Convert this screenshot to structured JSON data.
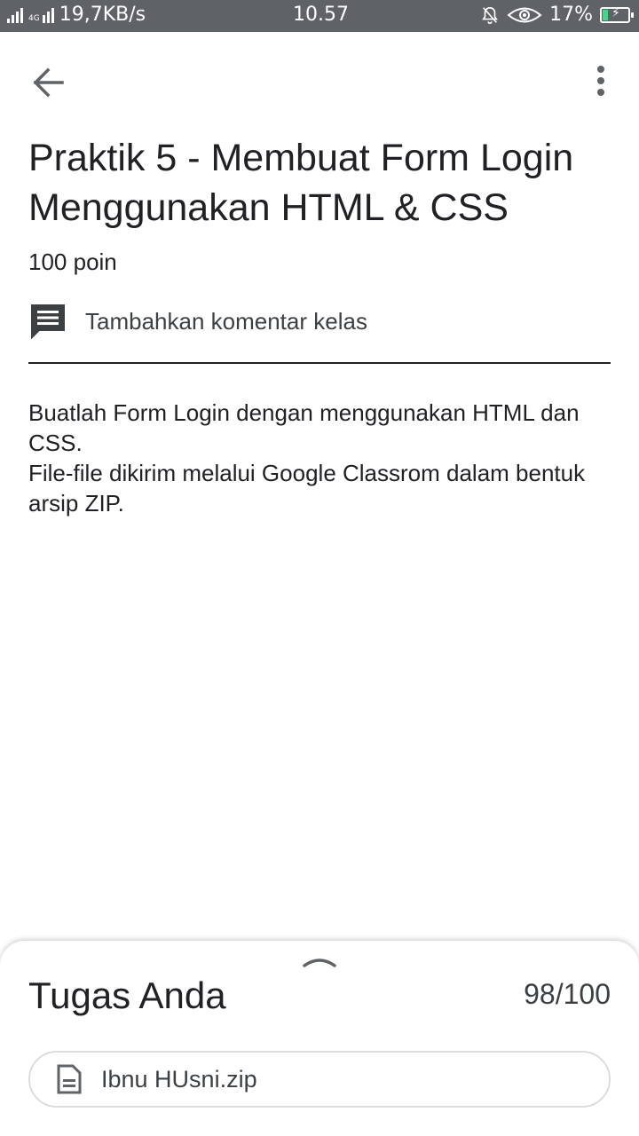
{
  "status_bar": {
    "network_speed": "19,7KB/s",
    "network_type": "4G",
    "time": "10.57",
    "battery": "17%",
    "icons": [
      "signal-icon",
      "signal-4g-icon",
      "mute-icon",
      "eye-icon",
      "battery-charging-icon"
    ]
  },
  "app_bar": {
    "back_icon": "arrow-back-icon",
    "menu_icon": "more-vert-icon"
  },
  "assignment": {
    "title": "Praktik 5 - Membuat Form Login Menggunakan HTML & CSS",
    "points": "100 poin",
    "comment_label": "Tambahkan komentar kelas",
    "comment_icon": "comment-icon",
    "description": [
      "Buatlah Form Login dengan menggunakan HTML dan CSS.",
      "File-file dikirim melalui Google Classrom dalam bentuk arsip ZIP."
    ]
  },
  "work_sheet": {
    "title": "Tugas Anda",
    "score": "98/100",
    "handle_icon": "chevron-up-icon",
    "attachment": {
      "icon": "file-icon",
      "name": "Ibnu HUsni.zip"
    }
  },
  "colors": {
    "status_bar": "#5f6368",
    "text_primary": "#202124",
    "text_secondary": "#3c4043",
    "battery_fill": "#3ddc84"
  }
}
